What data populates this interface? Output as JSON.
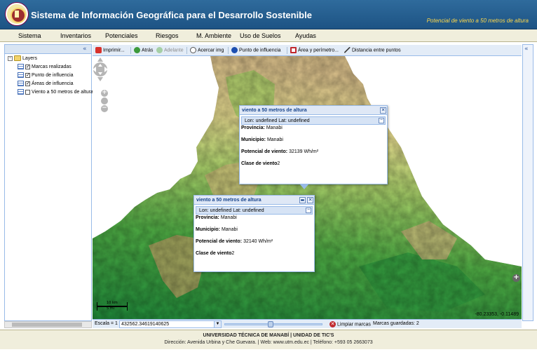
{
  "header": {
    "title": "Sistema de Información Geográfica para el Desarrollo Sostenible",
    "subtitle": "Potencial de viento a 50 metros de altura"
  },
  "menu": {
    "items": [
      "Sistema",
      "Inventarios",
      "Potenciales",
      "Riesgos",
      "M. Ambiente",
      "Uso de Suelos",
      "Ayudas"
    ]
  },
  "layers": {
    "root": "Layers",
    "items": [
      {
        "label": "Marcas realizadas",
        "checked": true
      },
      {
        "label": "Punto de influencia",
        "checked": true
      },
      {
        "label": "Áreas de influencia",
        "checked": true
      },
      {
        "label": "Viento a 50 metros de altura",
        "checked": false
      }
    ]
  },
  "toolbar": {
    "print": "Imprimir...",
    "back": "Atrás",
    "forward": "Adelante",
    "zoom_in": "Acercar img",
    "influence_point": "Punto de influencia",
    "area": "Área y perímetro...",
    "distance": "Distancia entre puntos"
  },
  "popups": [
    {
      "title": "viento a 50 metros de altura",
      "location": "Lon: undefined Lat: undefined",
      "provincia_label": "Provincia:",
      "provincia": "Manabi",
      "municipio_label": "Municipio:",
      "municipio": "Manabi",
      "potencial_label": "Potencial de viento:",
      "potencial": "32139 Wh/m²",
      "clase_label": "Clase de viento",
      "clase": "2"
    },
    {
      "title": "viento a 50 metros de altura",
      "location": "Lon: undefined Lat: undefined",
      "provincia_label": "Provincia:",
      "provincia": "Manabi",
      "municipio_label": "Municipio:",
      "municipio": "Manabi",
      "potencial_label": "Potencial de viento:",
      "potencial": "32140 Wh/m²",
      "clase_label": "Clase de viento",
      "clase": "2"
    }
  ],
  "map": {
    "scale_km": "10 km",
    "scale_mi": "5 mi",
    "coordinates": "-80.23353, -0.11489"
  },
  "bottombar": {
    "scale_label": "Escala = 1 :",
    "scale_value": "432562.34619140625",
    "clear_marks": "Limpiar marcas",
    "saved_marks": "Marcas guardadas: 2"
  },
  "footer": {
    "line1": "UNIVERSIDAD TÉCNICA DE MANABÍ  |  UNIDAD DE TIC'S",
    "line2": "Dirección: Avenida Urbina y Che Guevara.  |  Web: www.utm.edu.ec  |  Teléfono: +593 05 2663073"
  },
  "colors": {
    "header_blue": "#1d5384",
    "subtitle_yellow": "#ffd84a",
    "panel_border": "#99bbe8",
    "terrain_green": "#4fa84a",
    "terrain_brown": "#b58a57"
  }
}
